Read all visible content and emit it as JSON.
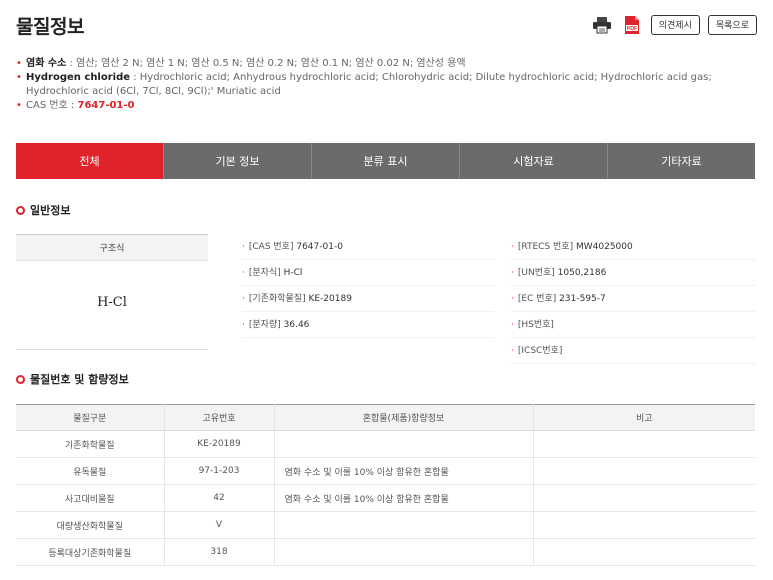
{
  "page": {
    "title": "물질정보"
  },
  "header": {
    "print_icon": "printer-icon",
    "pdf_icon": "pdf-icon",
    "pdf_label": "PDF",
    "feedback_label": "의견제시",
    "list_label": "목록으로"
  },
  "names": {
    "korean_label": "염화 수소",
    "korean_synonyms": " : 염산; 염산 2 N; 염산 1 N; 염산 0.5 N; 염산 0.2 N; 염산 0.1 N; 염산 0.02 N; 염산성 용액",
    "english_label": "Hydrogen chloride",
    "english_synonyms": " : Hydrochloric acid; Anhydrous hydrochloric acid; Chlorohydric acid; Dilute hydrochloric acid; Hydrochloric acid gas; Hydrochloric acid (6Cl, 7Cl, 8Cl, 9Cl);' Muriatic acid",
    "cas_label": "CAS 번호 : ",
    "cas_value": "7647-01-0"
  },
  "tabs": [
    {
      "label": "전체",
      "active": true
    },
    {
      "label": "기본 정보",
      "active": false
    },
    {
      "label": "분류 표시",
      "active": false
    },
    {
      "label": "시험자료",
      "active": false
    },
    {
      "label": "기타자료",
      "active": false
    }
  ],
  "general": {
    "section_title": "일반정보",
    "structure_header": "구조식",
    "formula": "H-Cl",
    "col1": [
      {
        "label": "[CAS 번호]",
        "value": "7647-01-0"
      },
      {
        "label": "[분자식]",
        "value": "H-Cl"
      },
      {
        "label": "[기존화학물질]",
        "value": "KE-20189"
      },
      {
        "label": "[분자량]",
        "value": "36.46"
      }
    ],
    "col2": [
      {
        "label": "[RTECS 번호]",
        "value": "MW4025000"
      },
      {
        "label": "[UN번호]",
        "value": "1050,2186"
      },
      {
        "label": "[EC 번호]",
        "value": "231-595-7"
      },
      {
        "label": "[HS번호]",
        "value": ""
      },
      {
        "label": "[ICSC번호]",
        "value": ""
      }
    ]
  },
  "substance": {
    "section_title": "물질번호 및 함량정보",
    "headers": [
      "물질구분",
      "고유번호",
      "혼합물(제품)함량정보",
      "비고"
    ],
    "rows": [
      [
        "기존화학물질",
        "KE-20189",
        "",
        ""
      ],
      [
        "유독물질",
        "97-1-203",
        "염화 수소 및 이를 10% 이상 함유한 혼합물",
        ""
      ],
      [
        "사고대비물질",
        "42",
        "염화 수소 및 이를 10% 이상 함유한 혼합물",
        ""
      ],
      [
        "대량생산화학물질",
        "V",
        "",
        ""
      ],
      [
        "등록대상기존화학물질",
        "318",
        "",
        ""
      ]
    ]
  },
  "colors": {
    "accent": "#e0232a",
    "tab_bg": "#6b6b6b"
  }
}
